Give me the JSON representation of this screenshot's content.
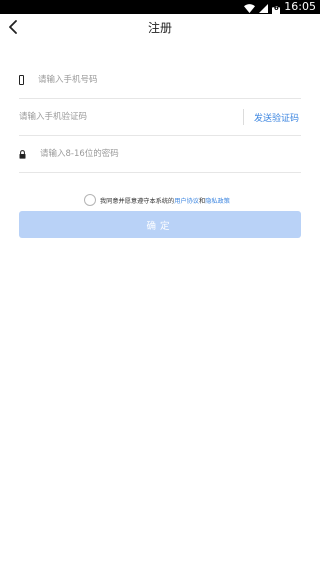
{
  "status_bar": {
    "time": "16:05",
    "icons": [
      "wifi-icon",
      "signal-icon",
      "battery-icon"
    ],
    "battery_level": "6"
  },
  "nav": {
    "title": "注册",
    "back_icon": "chevron-left-icon"
  },
  "form": {
    "phone": {
      "placeholder": "请输入手机号码",
      "icon": "phone-icon"
    },
    "code": {
      "placeholder": "请输入手机验证码",
      "send_label": "发送验证码"
    },
    "password": {
      "placeholder": "请输入8-16位的密码",
      "icon": "lock-icon"
    }
  },
  "agreement": {
    "prefix": "我同意并愿意遵守本系统的",
    "user_agreement": "用户协议",
    "and": "和",
    "privacy_policy": "隐私政策",
    "checked": false
  },
  "confirm_label": "确定",
  "colors": {
    "accent": "#3d86e0",
    "button_disabled": "#b9d2f7",
    "divider": "#e6e6e6"
  }
}
